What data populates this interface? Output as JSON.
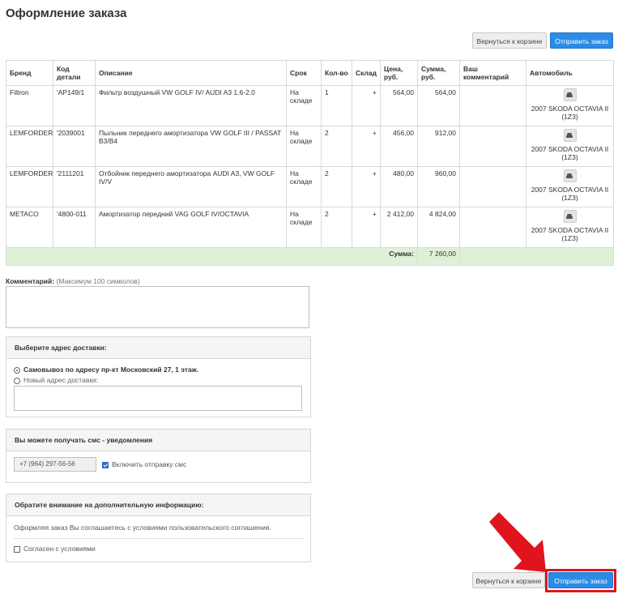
{
  "page": {
    "title": "Оформление заказа"
  },
  "top_actions": {
    "back_label": "Вернуться к корзине",
    "submit_label": "Отправить заказ"
  },
  "table": {
    "headers": {
      "brand": "Бренд",
      "code": "Код детали",
      "description": "Описание",
      "term": "Срок",
      "qty": "Кол-во",
      "stock": "Склад",
      "price": "Цена, руб.",
      "sum": "Сумма, руб.",
      "comment": "Ваш комментарий",
      "car": "Автомобиль"
    },
    "rows": [
      {
        "brand": "Filtron",
        "code": "'AP149/1",
        "description": "Фильтр воздушный VW GOLF IV/ AUDI A3 1.6-2.0",
        "term": "На складе",
        "qty": "1",
        "stock": "+",
        "price": "564,00",
        "sum": "564,00",
        "comment": "",
        "car": "2007 SKODA OCTAVIA II (1Z3)"
      },
      {
        "brand": "LEMFORDER",
        "code": "'2039001",
        "description": "Пыльник переднего амортизатора VW GOLF III / PASSAT B3/B4",
        "term": "На складе",
        "qty": "2",
        "stock": "+",
        "price": "456,00",
        "sum": "912,00",
        "comment": "",
        "car": "2007 SKODA OCTAVIA II (1Z3)"
      },
      {
        "brand": "LEMFORDER",
        "code": "'2111201",
        "description": "Отбойник переднего амортизатора AUDI A3, VW GOLF IV/V",
        "term": "На складе",
        "qty": "2",
        "stock": "+",
        "price": "480,00",
        "sum": "960,00",
        "comment": "",
        "car": "2007 SKODA OCTAVIA II (1Z3)"
      },
      {
        "brand": "METACO",
        "code": "'4800-011",
        "description": "Амортизатор передний VAG GOLF IV/OCTAVIA",
        "term": "На складе",
        "qty": "2",
        "stock": "+",
        "price": "2 412,00",
        "sum": "4 824,00",
        "comment": "",
        "car": "2007 SKODA OCTAVIA II (1Z3)"
      }
    ],
    "total_label": "Сумма:",
    "total_value": "7 260,00"
  },
  "comment": {
    "label": "Комментарий:",
    "hint": "(Максимум 100 символов)",
    "value": ""
  },
  "delivery": {
    "title": "Выберите адрес доставки:",
    "pickup_label": "Самовывоз по адресу пр-кт Московский 27, 1 этаж.",
    "new_address_label": "Новый адрес доставки:",
    "new_address_value": ""
  },
  "sms": {
    "title": "Вы можете получать смс - уведомления",
    "phone_value": "+7 (964) 297-56-56",
    "enable_label": "Включить отправку смс",
    "enabled": true
  },
  "notice": {
    "title": "Обратите внимание на дополнительную информацию:",
    "text": "Оформляя заказ Вы соглашаетесь с условиями пользовательского соглашения.",
    "agree_label": "Согласен с условиями",
    "agreed": false
  },
  "bottom_actions": {
    "back_label": "Вернуться к корзине",
    "submit_label": "Отправить заказ"
  },
  "colors": {
    "primary": "#2b8be6",
    "total_row": "#dff0d8",
    "annotation": "#e0141d"
  },
  "icons": {
    "car": "car-icon",
    "arrow": "red-arrow-annotation"
  }
}
